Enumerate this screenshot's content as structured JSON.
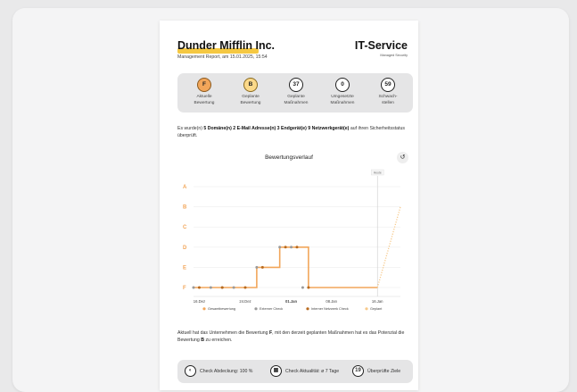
{
  "header": {
    "company": "Dunder Mifflin Inc.",
    "subtitle": "Management Report, am 15.01.2025, 15:54",
    "brand": "IT-Service",
    "brand_sub": "Managed Security"
  },
  "stats": [
    {
      "value": "F",
      "label1": "Aktuelle",
      "label2": "Bewertung",
      "style": "orange"
    },
    {
      "value": "B",
      "label1": "Geplante",
      "label2": "Bewertung",
      "style": "yellow"
    },
    {
      "value": "37",
      "label1": "Geplante",
      "label2": "Maßnahmen",
      "style": "plain"
    },
    {
      "value": "0",
      "label1": "Umgesetzte",
      "label2": "Maßnahmen",
      "style": "plain"
    },
    {
      "value": "59",
      "label1": "Schwach-",
      "label2": "stellen",
      "style": "plain"
    }
  ],
  "intro": {
    "pre": "Es wurde(n) ",
    "bold": "5 Domäne(n) 2 E-Mail Adresse(n) 3 Endgerät(e) 9 Netzwerkgerät(e)",
    "post": " auf ihren Sicherheitsstatus überprüft."
  },
  "chart_title": "Bewertungsverlauf",
  "reset_icon": "↺",
  "chart_data": {
    "type": "line",
    "title": "Bewertungsverlauf",
    "y_grades": [
      "A",
      "B",
      "C",
      "D",
      "E",
      "F"
    ],
    "x_ticks": [
      "16.Dez",
      "24.Dez",
      "01.Jan",
      "08.Jan",
      "16.Jan"
    ],
    "x_tick_days": [
      0,
      8,
      16,
      23,
      31
    ],
    "heute_label": "Heute",
    "heute_day": 31,
    "series": [
      {
        "name": "Gesamtbewertung",
        "color": "#f2a65a",
        "points": [
          [
            -1,
            "F"
          ],
          [
            0,
            "F"
          ],
          [
            2,
            "F"
          ],
          [
            4,
            "F"
          ],
          [
            6,
            "F"
          ],
          [
            8,
            "F"
          ],
          [
            10,
            "E"
          ],
          [
            12,
            "E"
          ],
          [
            14,
            "D"
          ],
          [
            16,
            "D"
          ],
          [
            18,
            "D"
          ],
          [
            19,
            "F"
          ],
          [
            23,
            "F"
          ],
          [
            31,
            "F"
          ]
        ]
      },
      {
        "name": "Externer Check",
        "color": "#9a9a9a",
        "points": [
          [
            -1,
            "F"
          ],
          [
            2,
            "F"
          ],
          [
            4,
            "F"
          ],
          [
            6,
            "F"
          ],
          [
            10,
            "E"
          ],
          [
            14,
            "D"
          ],
          [
            16,
            "D"
          ],
          [
            18,
            "F"
          ]
        ]
      },
      {
        "name": "Interner Netzwerk Check",
        "color": "#b86a1e",
        "points": [
          [
            0,
            "F"
          ],
          [
            4,
            "F"
          ],
          [
            8,
            "F"
          ],
          [
            11,
            "E"
          ],
          [
            15,
            "D"
          ],
          [
            17,
            "D"
          ],
          [
            19,
            "F"
          ]
        ]
      },
      {
        "name": "Geplant",
        "color": "#f7c98a",
        "points": [
          [
            31,
            "F"
          ],
          [
            32,
            "E"
          ],
          [
            33,
            "D"
          ],
          [
            34,
            "C"
          ],
          [
            35,
            "B"
          ]
        ]
      }
    ]
  },
  "bottom_text": {
    "pre": "Aktuell hat das Unternehmen die Bewertung ",
    "bold1": "F",
    "mid": ", mit den derzeit geplanten Maßnahmen hat es das Potenzial die Bewertung ",
    "bold2": "B",
    "post": " zu erreichen."
  },
  "footer": [
    {
      "icon": "◐",
      "icon_name": "gauge-icon",
      "text": "Check Abdeckung: 100 %"
    },
    {
      "icon": "▦",
      "icon_name": "calendar-icon",
      "text": "Check Aktualität: ø 7 Tage"
    },
    {
      "icon": "19",
      "icon_name": "count-badge",
      "text": "Überprüfte Ziele"
    }
  ]
}
